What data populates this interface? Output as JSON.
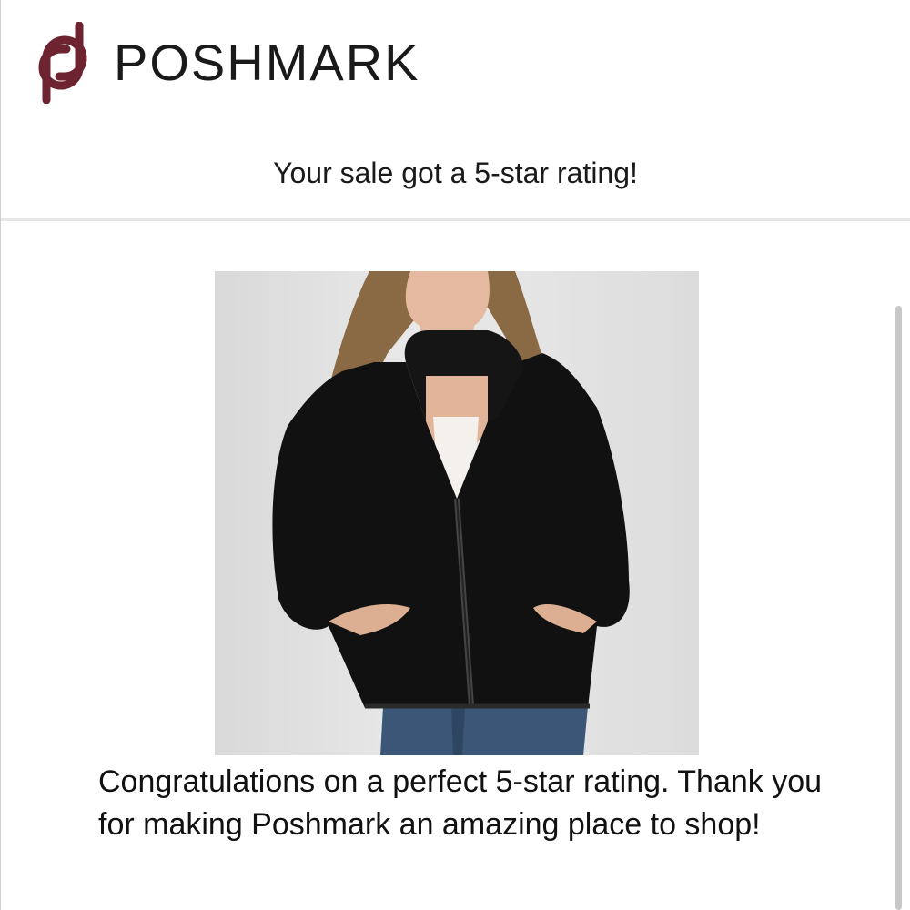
{
  "brand": {
    "name": "POSHMARK",
    "color": "#7a2232"
  },
  "email": {
    "subject": "Your sale got a 5-star rating!",
    "message": "Congratulations on a perfect 5-star rating. Thank you for making Poshmark an amazing place to shop!"
  },
  "product": {
    "image_description": "black-sherpa-zip-hoodie-jacket"
  }
}
